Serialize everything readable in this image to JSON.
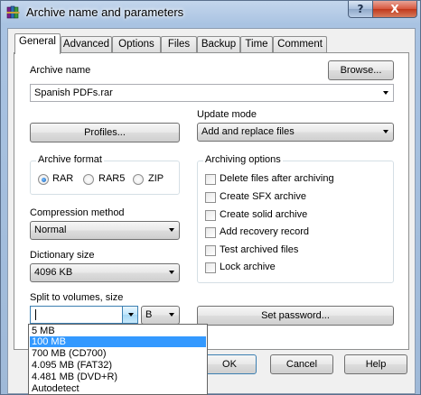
{
  "window": {
    "title": "Archive name and parameters",
    "help_glyph": "?",
    "close_glyph": "X"
  },
  "tabs": [
    {
      "label": "General",
      "active": true
    },
    {
      "label": "Advanced",
      "active": false
    },
    {
      "label": "Options",
      "active": false
    },
    {
      "label": "Files",
      "active": false
    },
    {
      "label": "Backup",
      "active": false
    },
    {
      "label": "Time",
      "active": false
    },
    {
      "label": "Comment",
      "active": false
    }
  ],
  "general": {
    "archive_name_label": "Archive name",
    "browse_label": "Browse...",
    "archive_name_value": "Spanish PDFs.rar",
    "update_mode_label": "Update mode",
    "profiles_label": "Profiles...",
    "update_mode_value": "Add and replace files",
    "archive_format_label": "Archive format",
    "formats": [
      {
        "label": "RAR",
        "selected": true
      },
      {
        "label": "RAR5",
        "selected": false
      },
      {
        "label": "ZIP",
        "selected": false
      }
    ],
    "compression_label": "Compression method",
    "compression_value": "Normal",
    "dictionary_label": "Dictionary size",
    "dictionary_value": "4096 KB",
    "split_label": "Split to volumes, size",
    "split_value": "",
    "split_unit": "B",
    "set_password_label": "Set password...",
    "archiving_options_label": "Archiving options",
    "options": [
      {
        "label": "Delete files after archiving",
        "checked": false
      },
      {
        "label": "Create SFX archive",
        "checked": false
      },
      {
        "label": "Create solid archive",
        "checked": false
      },
      {
        "label": "Add recovery record",
        "checked": false
      },
      {
        "label": "Test archived files",
        "checked": false
      },
      {
        "label": "Lock archive",
        "checked": false
      }
    ]
  },
  "buttons": {
    "ok": "OK",
    "cancel": "Cancel",
    "help": "Help"
  },
  "split_dropdown": {
    "items": [
      "5 MB",
      "100 MB",
      "700 MB  (CD700)",
      "4.095 MB  (FAT32)",
      "4.481 MB  (DVD+R)",
      "Autodetect"
    ],
    "selected_index": 1
  },
  "colors": {
    "selection": "#3399ff",
    "title_bar": "#a9c3e2",
    "close_button": "#c0391c"
  },
  "icons": {
    "app": "winrar-books-icon",
    "dropdown": "chevron-down-icon"
  }
}
